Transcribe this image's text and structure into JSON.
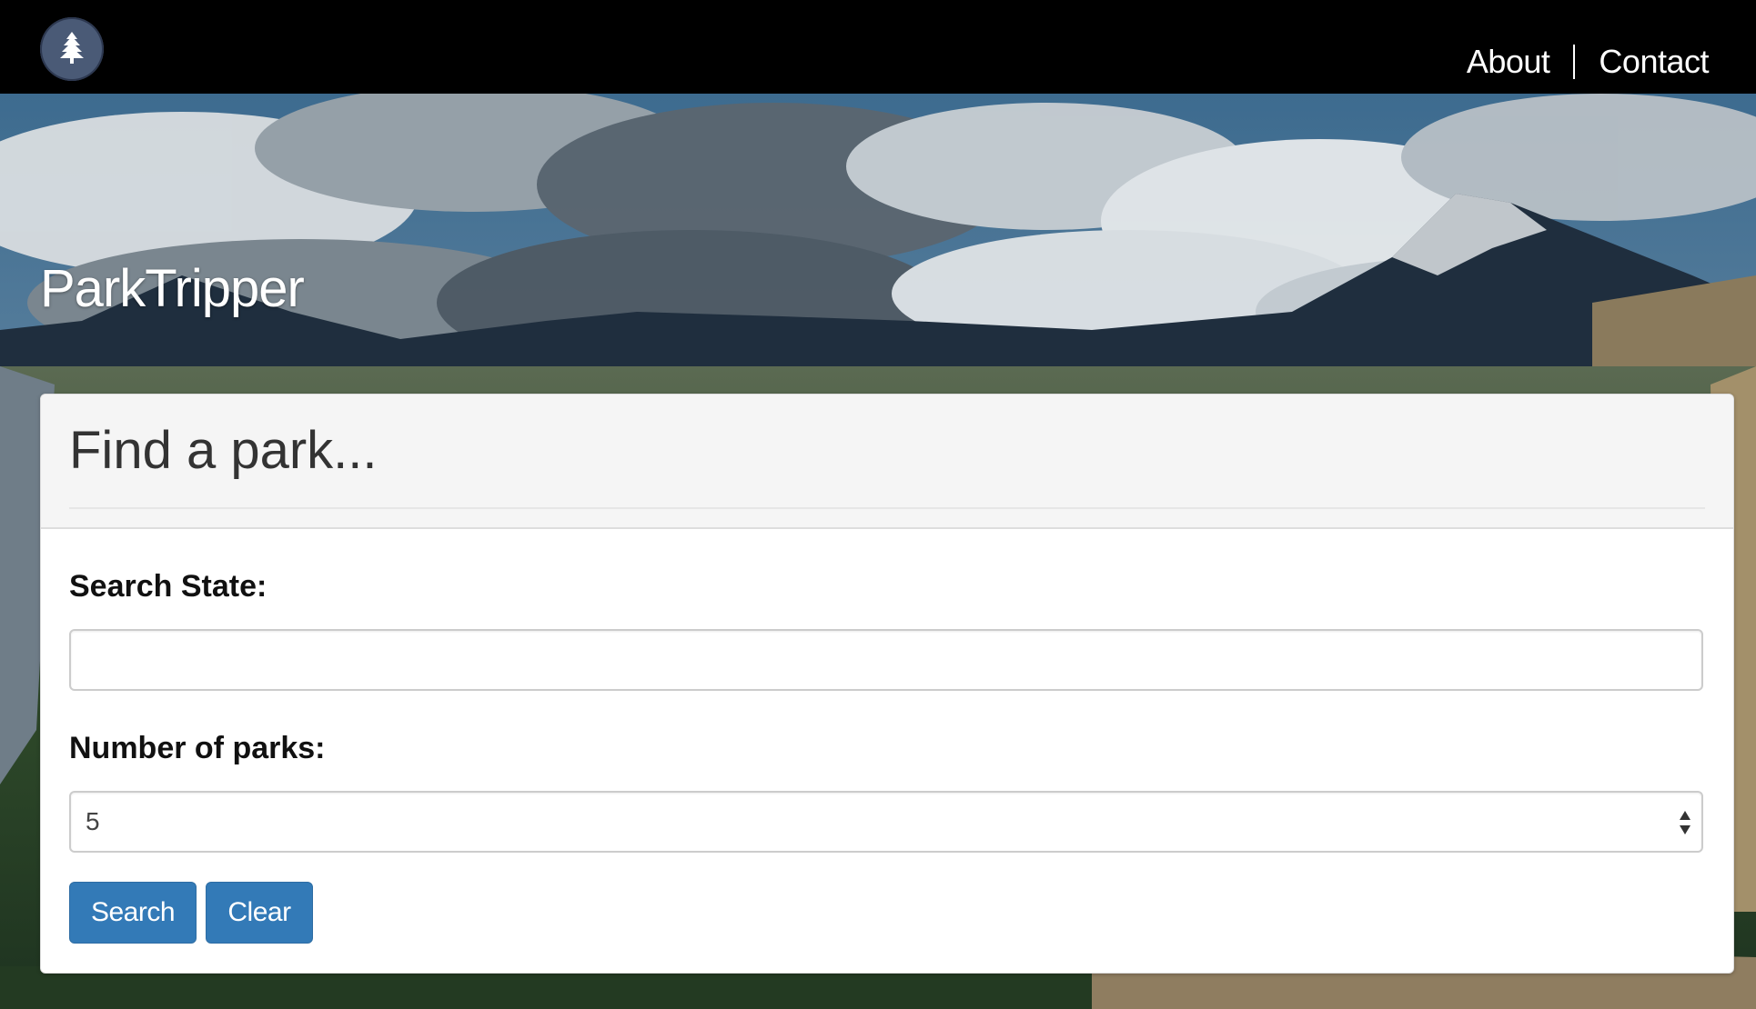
{
  "navbar": {
    "logo_icon": "pine-tree-icon",
    "links": [
      {
        "label": "About"
      },
      {
        "label": "Contact"
      }
    ]
  },
  "brand": {
    "name": "ParkTripper"
  },
  "search_panel": {
    "title": "Find a park...",
    "state_label": "Search State:",
    "state_value": "",
    "state_placeholder": "",
    "count_label": "Number of parks:",
    "count_value": "5",
    "search_button": "Search",
    "clear_button": "Clear"
  },
  "colors": {
    "navbar_bg": "#000000",
    "primary_button": "#337ab7",
    "panel_heading_bg": "#f5f5f5"
  }
}
